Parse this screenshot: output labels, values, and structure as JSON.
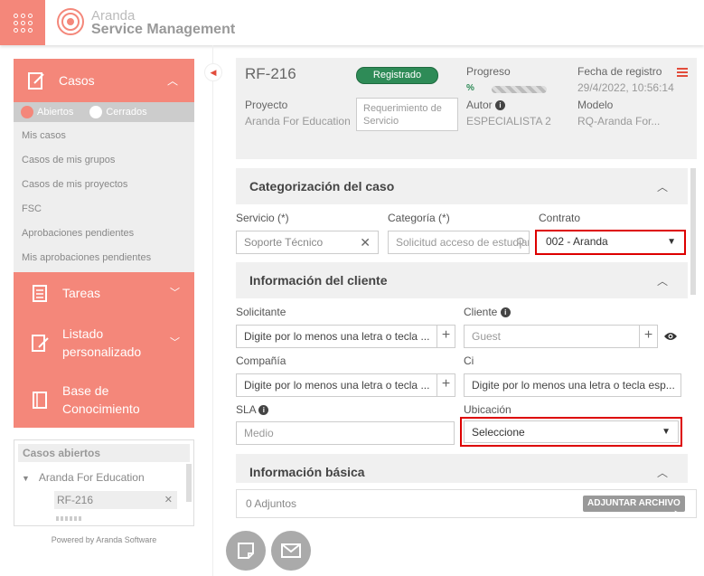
{
  "brand": {
    "line1": "Aranda",
    "line2": "Service Management"
  },
  "sidebar": {
    "cases_label": "Casos",
    "filter_open": "Abiertos",
    "filter_closed": "Cerrados",
    "case_items": [
      "Mis casos",
      "Casos de mis grupos",
      "Casos de mis proyectos",
      "FSC",
      "Aprobaciones pendientes",
      "Mis aprobaciones pendientes"
    ],
    "tasks_label": "Tareas",
    "custom_list_label1": "Listado",
    "custom_list_label2": "personalizado",
    "kb_label1": "Base de",
    "kb_label2": "Conocimiento",
    "open_cases_title": "Casos abiertos",
    "open_cases_group": "Aranda For Education",
    "open_case_chip": "RF-216",
    "powered": "Powered by Aranda Software"
  },
  "header": {
    "case_id": "RF-216",
    "status": "Registrado",
    "progress_label": "Progreso",
    "progress_pct": "%",
    "progress_value": 0.6,
    "date_label": "Fecha de registro",
    "date_value": "29/4/2022, 10:56:14",
    "project_label": "Proyecto",
    "project_value": "Aranda For Education",
    "request_type": "Requerimiento de Servicio",
    "author_label": "Autor",
    "author_value": "ESPECIALISTA 2",
    "model_label": "Modelo",
    "model_value": "RQ-Aranda For..."
  },
  "categorization": {
    "title": "Categorización del caso",
    "service_label": "Servicio (*)",
    "service_value": "Soporte Técnico",
    "category_label": "Categoría (*)",
    "category_value": "Solicitud acceso de estudiantes",
    "contract_label": "Contrato",
    "contract_value": "002 - Aranda"
  },
  "client": {
    "title": "Información del cliente",
    "requester_label": "Solicitante",
    "requester_placeholder": "Digite por lo menos una letra o tecla ...",
    "client_label": "Cliente",
    "client_value": "Guest",
    "company_label": "Compañía",
    "company_placeholder": "Digite por lo menos una letra o tecla ...",
    "ci_label": "Ci",
    "ci_placeholder": "Digite por lo menos una letra o tecla esp...",
    "sla_label": "SLA",
    "sla_value": "Medio",
    "location_label": "Ubicación",
    "location_value": "Seleccione"
  },
  "basic": {
    "title": "Información básica"
  },
  "attachments": {
    "label": "0 Adjuntos",
    "button": "ADJUNTAR ARCHIVO"
  }
}
